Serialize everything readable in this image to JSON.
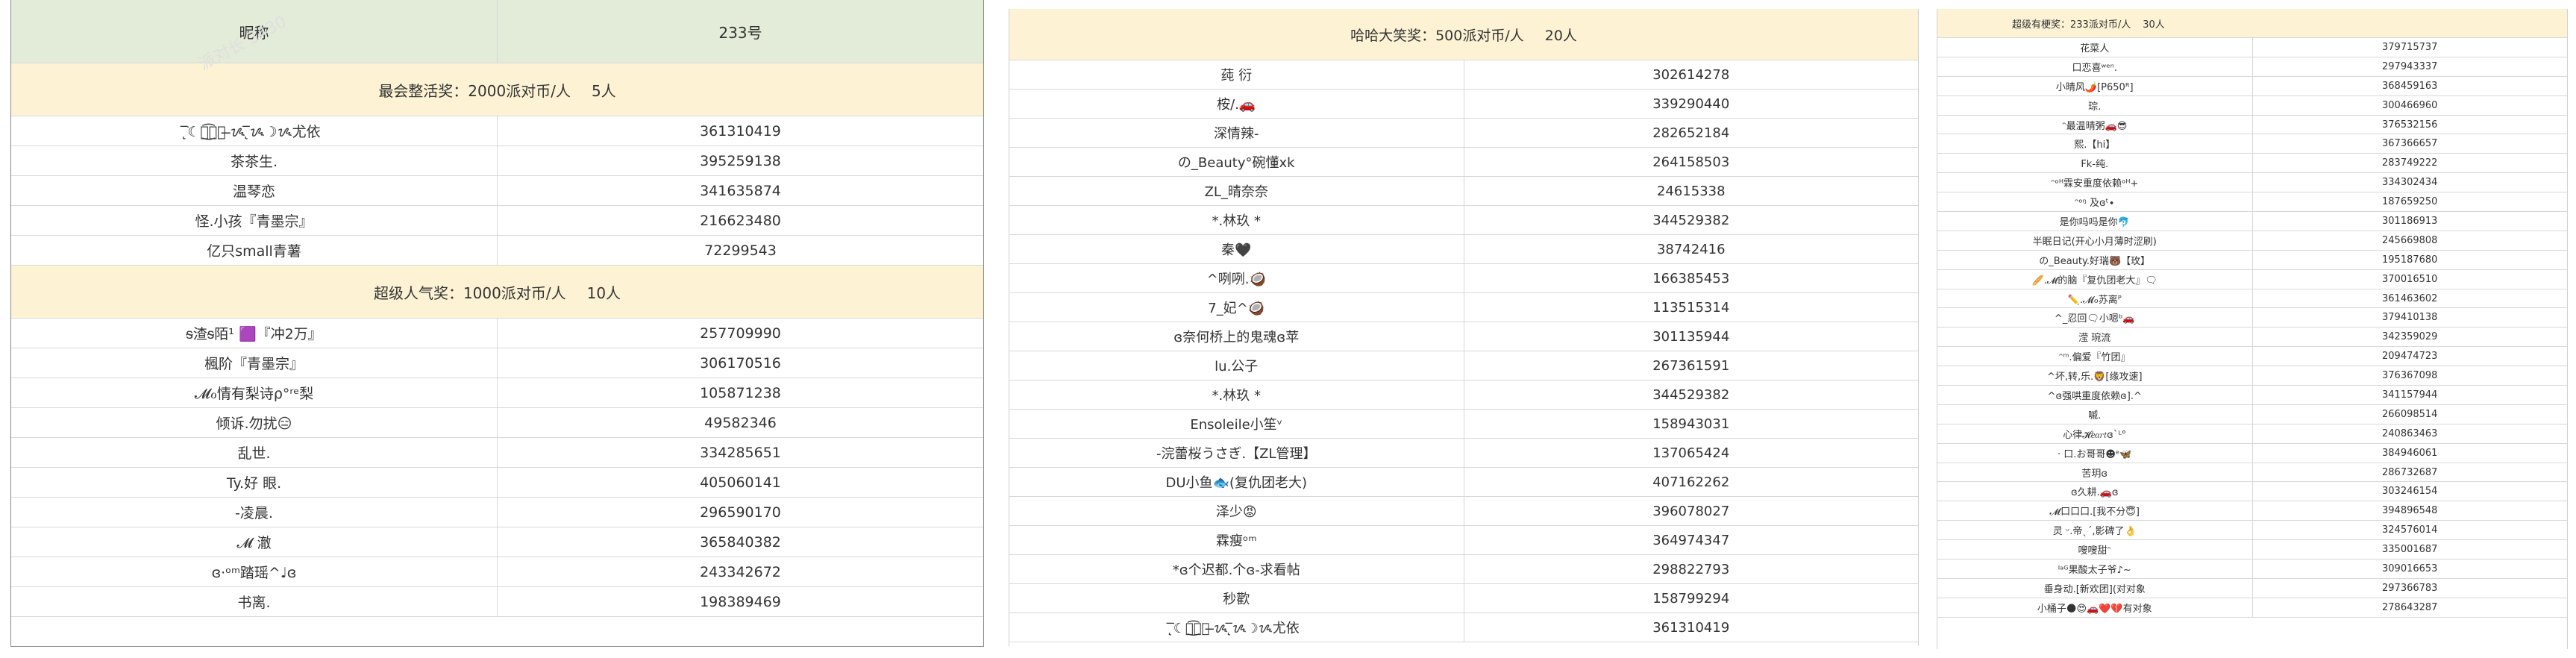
{
  "panel1": {
    "header": {
      "nickname": "昵称",
      "id": "233号"
    },
    "sections": [
      {
        "award": "最会整活奖：2000派对币/人",
        "count": "5人",
        "rows": [
          [
            "☾ֹ̨̅ᝰ͜͡⃝⃝ ̶ᝰ ̨̅ᝰ☽ᝰ尤依",
            "361310419"
          ],
          [
            "茶茶生.",
            "395259138"
          ],
          [
            "温琴恋",
            "341635874"
          ],
          [
            "怪.小孩『青墨宗』",
            "216623480"
          ],
          [
            "亿只small青薯",
            "72299543"
          ]
        ]
      },
      {
        "award": "超级人气奖：1000派对币/人",
        "count": "10人",
        "rows": [
          [
            "ᵴ渣ᵴ陌¹ 🟪『冲2万』",
            "257709990"
          ],
          [
            "楓阶『青墨宗』",
            "306170516"
          ],
          [
            "𝓜ℴ情有梨诗ρ°ʳᵉ梨",
            "105871238"
          ],
          [
            "倾诉.勿扰😑",
            "49582346"
          ],
          [
            "乱世.",
            "334285651"
          ],
          [
            "Ty.好 眼.",
            "405060141"
          ],
          [
            "-凌晨.",
            "296590170"
          ],
          [
            "𝓜 澈",
            "365840382"
          ],
          [
            "ɞ·ᵒᵐ踏瑶^♩ɞ",
            "243342672"
          ],
          [
            "书离.",
            "198389469"
          ]
        ]
      }
    ]
  },
  "panel2": {
    "award": "哈哈大笑奖：500派对币/人",
    "count": "20人",
    "rows": [
      [
        "莼 衍",
        "302614278"
      ],
      [
        "桉/.🚗",
        "339290440"
      ],
      [
        "深情辣-",
        "282652184"
      ],
      [
        "の_Beauty°碗懂xk",
        "264158503"
      ],
      [
        "ZL_晴奈奈",
        "24615338"
      ],
      [
        "*.林玖 *",
        "344529382"
      ],
      [
        "秦🖤",
        "38742416"
      ],
      [
        "^咧咧.🥥",
        "166385453"
      ],
      [
        "7_妃^🥥",
        "113515314"
      ],
      [
        "ɞ奈何桥上的鬼魂ɞ苹",
        "301135944"
      ],
      [
        "lu.公子",
        "267361591"
      ],
      [
        "*.林玖 *",
        "344529382"
      ],
      [
        "Ensoleile小笙ᵛ",
        "158943031"
      ],
      [
        "-浣蕾桜うさぎ.【ZL管理】",
        "137065424"
      ],
      [
        "DU小鱼🐟(复仇团老大)",
        "407162262"
      ],
      [
        "泽少😡",
        "396078027"
      ],
      [
        "霖瘦ᵒᵐ",
        "364974347"
      ],
      [
        "*ɞ个迟都.个ɞ-求看帖",
        "298822793"
      ],
      [
        "秒歡",
        "158799294"
      ],
      [
        "☾ֹ̨̅ᝰ͜͡⃝⃝ ̶ᝰ ̨̅ᝰ☽ᝰ尤依",
        "361310419"
      ]
    ]
  },
  "panel3": {
    "award": "超级有梗奖：233派对币/人",
    "count": "30人",
    "rows": [
      [
        "花菜人",
        "379715737"
      ],
      [
        "口恋喜ʷᵉⁿ.",
        "297943337"
      ],
      [
        "小晴风🌶️[P650ᴿ]",
        "368459163"
      ],
      [
        "琮.",
        "300466960"
      ],
      [
        "ᵔ最温晴粥🚗😎",
        "376532156"
      ],
      [
        "熙.【hi】",
        "367366657"
      ],
      [
        "Fk-纯.",
        "283749222"
      ],
      [
        "ᵔᵒᴴ霖安重度依赖ᵒᴴ+",
        "334302434"
      ],
      [
        "ᵔᵒᵑ 及ɞᵗ∙",
        "187659250"
      ],
      [
        "是你吗吗是你🐬",
        "301186913"
      ],
      [
        "半眠日记(开心小月薄时涩刷)",
        "245669808"
      ],
      [
        "の_Beauty.好瑞🐻【玫】",
        "195187680"
      ],
      [
        "🥖.𝓜的脑『复仇团老大』🗨",
        "370016510"
      ],
      [
        "✏️.𝓜ℴ苏离ᴾ",
        "361463602"
      ],
      [
        "^_忍回🗨小嗯ᵇ🚗",
        "379410138"
      ],
      [
        "滢 琬流",
        "342359029"
      ],
      [
        "ᵔᵐ.偏爱『竹团』",
        "209474723"
      ],
      [
        "^坏,转,乐.🦁[缘攻速]",
        "376367098"
      ],
      [
        "^ɞ强哄重度依赖ɞ].^",
        "341157944"
      ],
      [
        "嘁.",
        "266098514"
      ],
      [
        "心律𝓗𝑒𝑎𝑟𝑡ɞ`ᴸ°",
        "240863463"
      ],
      [
        "· 口.お哥哥☻ᵉ🦋",
        "384946061"
      ],
      [
        "苦玥ɞ",
        "286732687"
      ],
      [
        "ɞ久耕.🚗ɞ",
        "303246154"
      ],
      [
        "𝓜口口口.[我不分😇]",
        "394896548"
      ],
      [
        "灵 ᵕ.帝ˎˊ,影碑了👌",
        "324576014"
      ],
      [
        "嗖嗖甜ᵔ",
        "335001687"
      ],
      [
        "ᴵᵃᴳ果酸太子爷♪~",
        "309016653"
      ],
      [
        "垂身动.[新欢团](对对象",
        "297366783"
      ],
      [
        "小桶子🌑😍🚗❤️💔有对象",
        "278643287"
      ]
    ]
  },
  "watermark": "派对长 3430",
  "colors": {
    "header_green": "#e3ecd8",
    "award_yellow": "#fdf3d4",
    "grid": "#d8d8d8"
  }
}
